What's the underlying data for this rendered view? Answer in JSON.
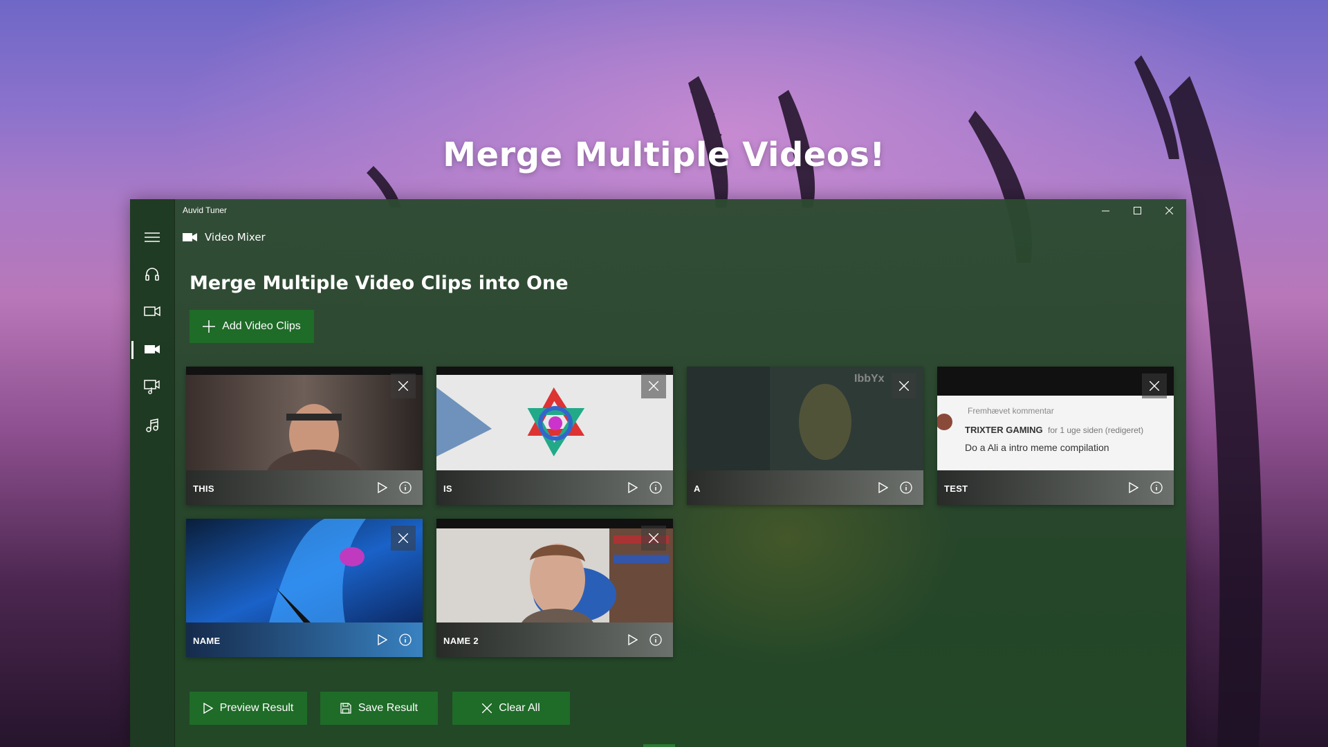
{
  "hero": {
    "title": "Merge Multiple Videos!"
  },
  "window": {
    "title": "Auvid Tuner"
  },
  "header": {
    "section_label": "Video Mixer"
  },
  "main": {
    "title": "Merge Multiple Video Clips into One",
    "add_button_label": "Add Video Clips"
  },
  "clips": [
    {
      "label": "THIS"
    },
    {
      "label": "IS"
    },
    {
      "label": "A"
    },
    {
      "label": "TEST"
    },
    {
      "label": "NAME"
    },
    {
      "label": "NAME 2"
    }
  ],
  "thumbnails": {
    "clip2_overlay": "IbbYx",
    "clip4_comment": {
      "heading": "Fremhævet kommentar",
      "author": "TRIXTER GAMING",
      "meta": "for 1 uge siden (redigeret)",
      "text": "Do a Ali a intro meme compilation"
    }
  },
  "actions": {
    "preview_label": "Preview Result",
    "save_label": "Save Result",
    "clear_label": "Clear All"
  },
  "icons": {
    "menu": "hamburger-icon",
    "audio": "headphones-icon",
    "video": "video-camera-icon",
    "mixer": "video-mixer-icon",
    "audio_video": "music-video-icon",
    "music": "music-note-icon"
  },
  "colors": {
    "accent": "#1f6b28",
    "window_bg": "#2c4a30",
    "rail_bg": "#1e3a22"
  }
}
